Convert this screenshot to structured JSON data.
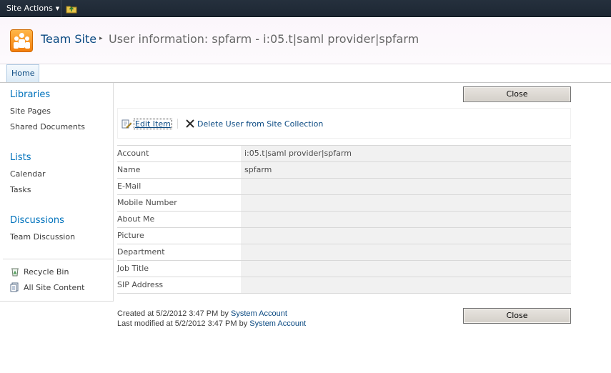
{
  "topbar": {
    "site_actions_label": "Site Actions",
    "caret": "▼",
    "nav_up_icon": "navigate-up-icon"
  },
  "title": {
    "site_name": "Team Site",
    "separator": "▸",
    "page_title": "User information: spfarm - i:05.t|saml provider|spfarm"
  },
  "topnav": {
    "home_tab": "Home"
  },
  "leftnav": {
    "libraries": {
      "heading": "Libraries",
      "items": [
        "Site Pages",
        "Shared Documents"
      ]
    },
    "lists": {
      "heading": "Lists",
      "items": [
        "Calendar",
        "Tasks"
      ]
    },
    "discussions": {
      "heading": "Discussions",
      "items": [
        "Team Discussion"
      ]
    },
    "bottom": {
      "recycle_bin": "Recycle Bin",
      "all_site_content": "All Site Content"
    }
  },
  "main": {
    "close_label": "Close",
    "toolbar": {
      "edit_item": "Edit Item",
      "delete_user": "Delete User from Site Collection"
    },
    "properties": [
      {
        "label": "Account",
        "value": "i:05.t|saml provider|spfarm"
      },
      {
        "label": "Name",
        "value": "spfarm"
      },
      {
        "label": "E-Mail",
        "value": ""
      },
      {
        "label": "Mobile Number",
        "value": ""
      },
      {
        "label": "About Me",
        "value": ""
      },
      {
        "label": "Picture",
        "value": ""
      },
      {
        "label": "Department",
        "value": ""
      },
      {
        "label": "Job Title",
        "value": ""
      },
      {
        "label": "SIP Address",
        "value": ""
      }
    ],
    "footer": {
      "created_prefix": "Created at 5/2/2012 3:47 PM  by",
      "created_by": "System Account",
      "modified_prefix": "Last modified at 5/2/2012 3:47 PM  by",
      "modified_by": "System Account"
    }
  },
  "colors": {
    "link_blue": "#0072bc",
    "topbar_bg": "#1d2733",
    "value_cell_bg": "#f1f1f1",
    "logo_orange": "#f37e0c"
  }
}
